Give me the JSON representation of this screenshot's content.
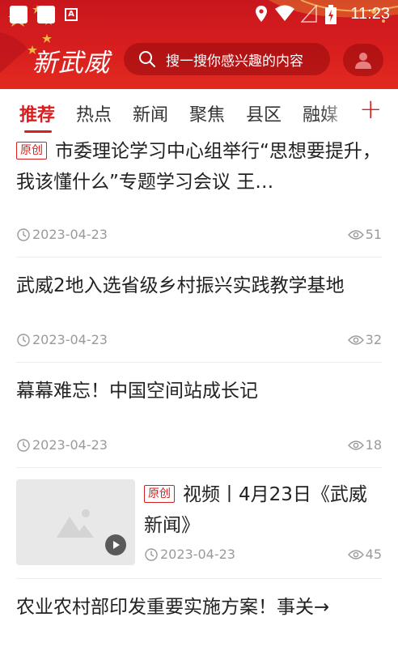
{
  "status_bar": {
    "time": "11:23",
    "notification_icon": "A"
  },
  "header": {
    "logo": "新武威",
    "search_placeholder": "搜一搜你感兴趣的内容",
    "icons": [
      "search-icon",
      "user-icon"
    ]
  },
  "tabs": [
    {
      "label": "推荐",
      "active": true
    },
    {
      "label": "热点",
      "active": false
    },
    {
      "label": "新闻",
      "active": false
    },
    {
      "label": "聚焦",
      "active": false
    },
    {
      "label": "县区",
      "active": false
    },
    {
      "label": "融媒",
      "active": false
    }
  ],
  "add_tab_label": "+",
  "feed": [
    {
      "badge": "原创",
      "title": "市委理论学习中心组举行“思想要提升，我该懂什么”专题学习会议 王…",
      "date": "2023-04-23",
      "views": "51"
    },
    {
      "badge": "",
      "title": "武威2地入选省级乡村振兴实践教学基地",
      "date": "2023-04-23",
      "views": "32"
    },
    {
      "badge": "",
      "title": "幕幕难忘！中国空间站成长记",
      "date": "2023-04-23",
      "views": "18"
    },
    {
      "badge": "原创",
      "title": "视频丨4月23日《武威新闻》",
      "date": "2023-04-23",
      "views": "45",
      "has_video_thumb": true
    },
    {
      "badge": "",
      "title": "农业农村部印发重要实施方案！事关→",
      "date": "",
      "views": ""
    }
  ],
  "colors": {
    "brand_red": "#d81e1e",
    "meta_gray": "#9a9a9a",
    "divider": "#ececec"
  }
}
